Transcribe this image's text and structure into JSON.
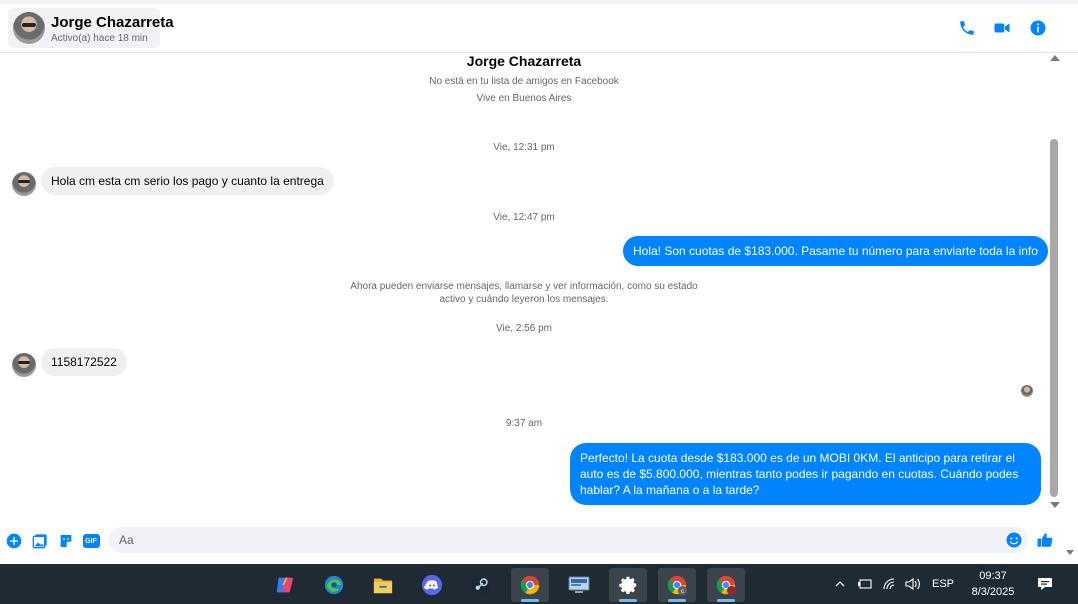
{
  "header": {
    "contact_name": "Jorge Chazarreta",
    "contact_status": "Activo(a) hace 18 min",
    "icons": [
      "phone-icon",
      "video-icon",
      "info-icon"
    ],
    "accent_color": "#0084ff"
  },
  "profile": {
    "name": "Jorge Chazarreta",
    "line1": "No está en tu lista de amigos en Facebook",
    "line2": "Vive en Buenos Aires"
  },
  "messages": [
    {
      "type": "timestamp",
      "text": "Vie, 12:31 pm"
    },
    {
      "type": "incoming",
      "text": "Hola  cm  esta  cm serio los pago y cuanto la entrega"
    },
    {
      "type": "timestamp",
      "text": "Vie, 12:47 pm"
    },
    {
      "type": "outgoing",
      "text": "Hola! Son cuotas de $183.000. Pasame tu número para enviarte toda la info"
    },
    {
      "type": "notice",
      "line1": "Ahora pueden enviarse mensajes, llamarse y ver información, como su estado",
      "line2": "activo y cuándo leyeron los mensajes."
    },
    {
      "type": "timestamp",
      "text": "Vie, 2:56 pm"
    },
    {
      "type": "incoming",
      "text": "1158172522"
    },
    {
      "type": "timestamp",
      "text": "9:37 am"
    },
    {
      "type": "outgoing",
      "lines": [
        "Perfecto! La cuota desde $183.000 es de un MOBI 0KM. El anticipo para retirar el",
        "auto es de $5.800.000, mientras tanto podes ir pagando en cuotas. Cuándo podes",
        "hablar? A la mañana o a la tarde?"
      ]
    }
  ],
  "composer": {
    "placeholder": "Aa",
    "value": "",
    "gif_label": "GIF",
    "icons": [
      "plus-icon",
      "image-icon",
      "sticker-icon",
      "gif-icon",
      "emoji-icon",
      "like-icon"
    ]
  },
  "taskbar": {
    "apps": [
      "copilot-icon",
      "edge-icon",
      "file-explorer-icon",
      "discord-icon",
      "steam-icon",
      "chrome-icon",
      "control-panel-icon",
      "settings-icon",
      "chrome-profile-c-icon",
      "chrome-profile-active-icon"
    ],
    "language": "ESP",
    "time": "09:37",
    "date": "8/3/2025"
  }
}
